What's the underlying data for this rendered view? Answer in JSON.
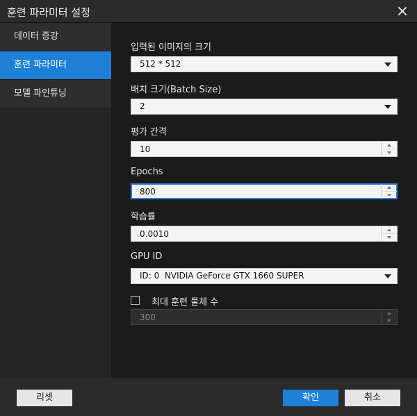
{
  "window": {
    "title": "훈련 파라미터 설정"
  },
  "sidebar": {
    "items": [
      {
        "label": "데이터 증강"
      },
      {
        "label": "훈련 파라미터"
      },
      {
        "label": "모델 파인튜닝"
      }
    ],
    "active_index": 1
  },
  "form": {
    "input_size": {
      "label": "입력된 이미지의 크기",
      "value": "512 * 512"
    },
    "batch_size": {
      "label": "배치 크기(Batch Size)",
      "value": "2"
    },
    "eval_interval": {
      "label": "평가 간격",
      "value": "10"
    },
    "epochs": {
      "label": "Epochs",
      "value": "800"
    },
    "learning_rate": {
      "label": "학습률",
      "value": "0.0010"
    },
    "gpu_id": {
      "label": "GPU ID",
      "value": "ID: 0  NVIDIA GeForce GTX 1660 SUPER"
    },
    "max_objects": {
      "label": "최대 훈련 물체 수",
      "checked": false,
      "value": "300"
    }
  },
  "footer": {
    "reset_label": "리셋",
    "confirm_label": "확인",
    "cancel_label": "취소"
  },
  "colors": {
    "accent": "#1e7fd6"
  }
}
